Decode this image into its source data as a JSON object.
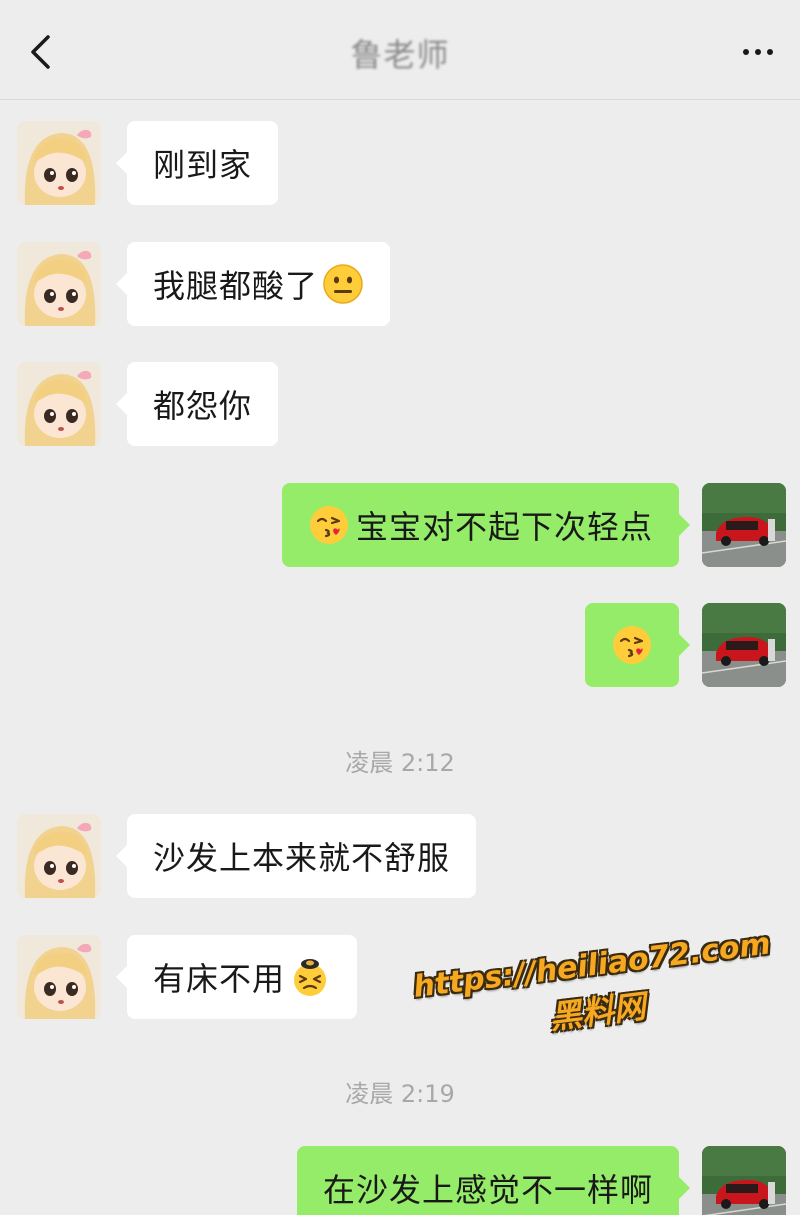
{
  "header": {
    "title": "鲁老师",
    "back_icon": "chevron-left-icon",
    "more_icon": "more-horizontal-icon"
  },
  "colors": {
    "background": "#ededed",
    "incoming_bubble": "#ffffff",
    "outgoing_bubble": "#95ec69",
    "timestamp_text": "#a8a8a8",
    "watermark": "#f6a820"
  },
  "messages": [
    {
      "side": "left",
      "text": "刚到家"
    },
    {
      "side": "left",
      "text": "我腿都酸了",
      "emoji": "neutral-face-emoji"
    },
    {
      "side": "left",
      "text": "都怨你"
    },
    {
      "side": "right",
      "text": "宝宝对不起下次轻点",
      "emoji": "kissing-face-emoji"
    },
    {
      "side": "right",
      "text": "",
      "emoji": "kissing-face-emoji"
    },
    {
      "side": "left",
      "text": "沙发上本来就不舒服"
    },
    {
      "side": "left",
      "text": "有床不用",
      "emoji": "frustrated-face-emoji"
    },
    {
      "side": "right",
      "text": "在沙发上感觉不一样啊"
    }
  ],
  "timestamps": [
    "凌晨 2:12",
    "凌晨 2:19"
  ],
  "watermark": {
    "url": "https://heiliao72.com",
    "name": "黑料网"
  }
}
